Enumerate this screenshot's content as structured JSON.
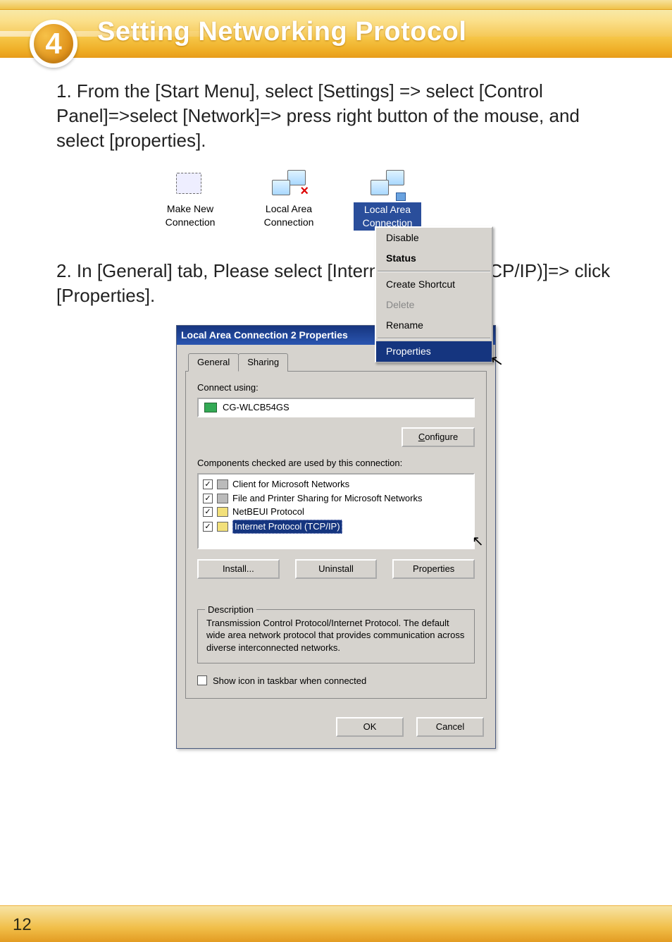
{
  "chapterNumber": "4",
  "headerTitle": "Setting Networking Protocol",
  "step1": "1. From the [Start Menu], select [Settings] => select [Control Panel]=>select [Network]=> press right button of the mouse, and select [properties].",
  "step2": "2. In [General] tab, Please select [Internet Protocol (TCP/IP)]=> click [Properties].",
  "pageNumber": "12",
  "figure1": {
    "icons": [
      {
        "caption": "Make New Connection",
        "kind": "new"
      },
      {
        "caption": "Local Area Connection",
        "kind": "lan-x"
      },
      {
        "caption": "Local Area Connection",
        "kind": "lan",
        "selected": true
      }
    ],
    "menu": {
      "items": [
        {
          "label": "Disable",
          "state": "normal"
        },
        {
          "label": "Status",
          "state": "bold"
        },
        {
          "sep": true
        },
        {
          "label": "Create Shortcut",
          "state": "normal"
        },
        {
          "label": "Delete",
          "state": "disabled"
        },
        {
          "label": "Rename",
          "state": "normal"
        },
        {
          "sep": true
        },
        {
          "label": "Properties",
          "state": "selected"
        }
      ]
    }
  },
  "dialog": {
    "title": "Local Area Connection 2 Properties",
    "helpGlyph": "?",
    "closeGlyph": "×",
    "tabs": {
      "active": "General",
      "other": "Sharing"
    },
    "connectUsingLabel": "Connect using:",
    "adapter": "CG-WLCB54GS",
    "configureBtn": "Configure",
    "componentsLabel": "Components checked are used by this connection:",
    "components": [
      {
        "label": "Client for Microsoft Networks",
        "checked": true,
        "cls": "client"
      },
      {
        "label": "File and Printer Sharing for Microsoft Networks",
        "checked": true,
        "cls": "fps"
      },
      {
        "label": "NetBEUI Protocol",
        "checked": true,
        "cls": "netbeui"
      },
      {
        "label": "Internet Protocol (TCP/IP)",
        "checked": true,
        "cls": "tcpip",
        "selected": true
      }
    ],
    "installBtn": "Install...",
    "uninstallBtn": "Uninstall",
    "propertiesBtn": "Properties",
    "descriptionLegend": "Description",
    "descriptionText": "Transmission Control Protocol/Internet Protocol. The default wide area network protocol that provides communication across diverse interconnected networks.",
    "showIconLabel": "Show icon in taskbar when connected",
    "okBtn": "OK",
    "cancelBtn": "Cancel"
  }
}
